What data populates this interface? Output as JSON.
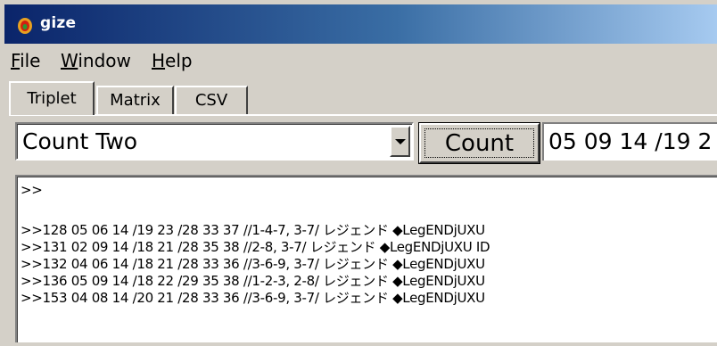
{
  "window": {
    "title": "gize"
  },
  "menu": {
    "file": {
      "accel": "F",
      "rest": "ile"
    },
    "window": {
      "accel": "W",
      "rest": "indow"
    },
    "help": {
      "accel": "H",
      "rest": "elp"
    }
  },
  "tabs": [
    {
      "label": "Triplet",
      "active": true
    },
    {
      "label": "Matrix",
      "active": false
    },
    {
      "label": "CSV",
      "active": false
    }
  ],
  "combo": {
    "selected": "Count Two"
  },
  "count_button": {
    "label": "Count"
  },
  "number_field": {
    "value": "05 09 14 /19 2"
  },
  "output": {
    "lines": [
      ">>",
      "",
      ">>128  05 06 14 /19 23 /28 33 37 //1-4-7, 3-7/  レジェンド ◆LegENDjUXU",
      ">>131  02 09 14 /18 21 /28 35 38 //2-8, 3-7/  レジェンド ◆LegENDjUXU ID",
      ">>132  04 06 14 /18 21 /28 33 36 //3-6-9, 3-7/  レジェンド ◆LegENDjUXU",
      ">>136  05 09 14 /18 22 /29 35 38 //1-2-3, 2-8/  レジェンド ◆LegENDjUXU",
      ">>153  04 08 14 /20 21 /28 33 36 //3-6-9, 3-7/  レジェンド ◆LegENDjUXU"
    ]
  },
  "colors": {
    "titlebar_start": "#0a246a",
    "titlebar_end": "#a6caf0",
    "face": "#d4d0c8"
  },
  "icons": {
    "app": "app-flame-icon",
    "dropdown": "chevron-down-icon"
  }
}
